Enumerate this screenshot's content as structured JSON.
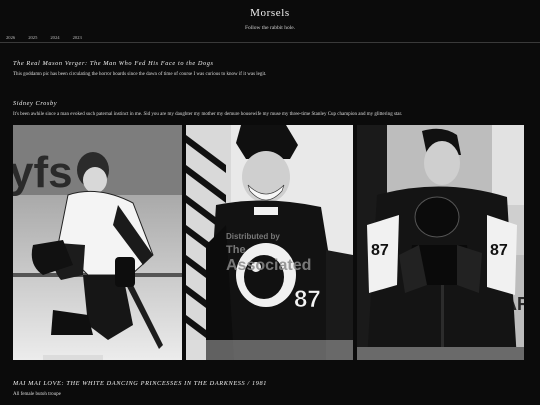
{
  "site": {
    "title": "Morsels",
    "tagline": "Follow the rabbit hole."
  },
  "nav": {
    "years": [
      "2026",
      "2025",
      "2024",
      "2023"
    ]
  },
  "posts": [
    {
      "title": "The Real Mason Verger: The Man Who Fed His Face to the Dogs",
      "body": "This goddamn pic has been circulating the horror boards since the dawn of time of course I was curious to know if it was legit."
    },
    {
      "title": "Sidney Crosby",
      "body": "It's been awhile since a man evoked such paternal instinct in me. Sid you are my daughter my mother my demure housewife my muse my three-time Stanley Cup champion and my glittering star."
    },
    {
      "title": "MAI MAI LOVE: THE WHITE DANCING PRINCESSES IN THE DARKNESS / 1981",
      "body": "All female butoh troupe"
    }
  ],
  "photos": {
    "jersey_number": "87",
    "watermark_line1": "Distributed by",
    "watermark_line2": "The",
    "watermark_line3": "Associated",
    "bg_text_left": "yfs",
    "bg_text_right": "MAR"
  },
  "colors": {
    "background": "#0b0b0b",
    "text": "#e6e6e6",
    "divider": "#3a3a3a"
  }
}
